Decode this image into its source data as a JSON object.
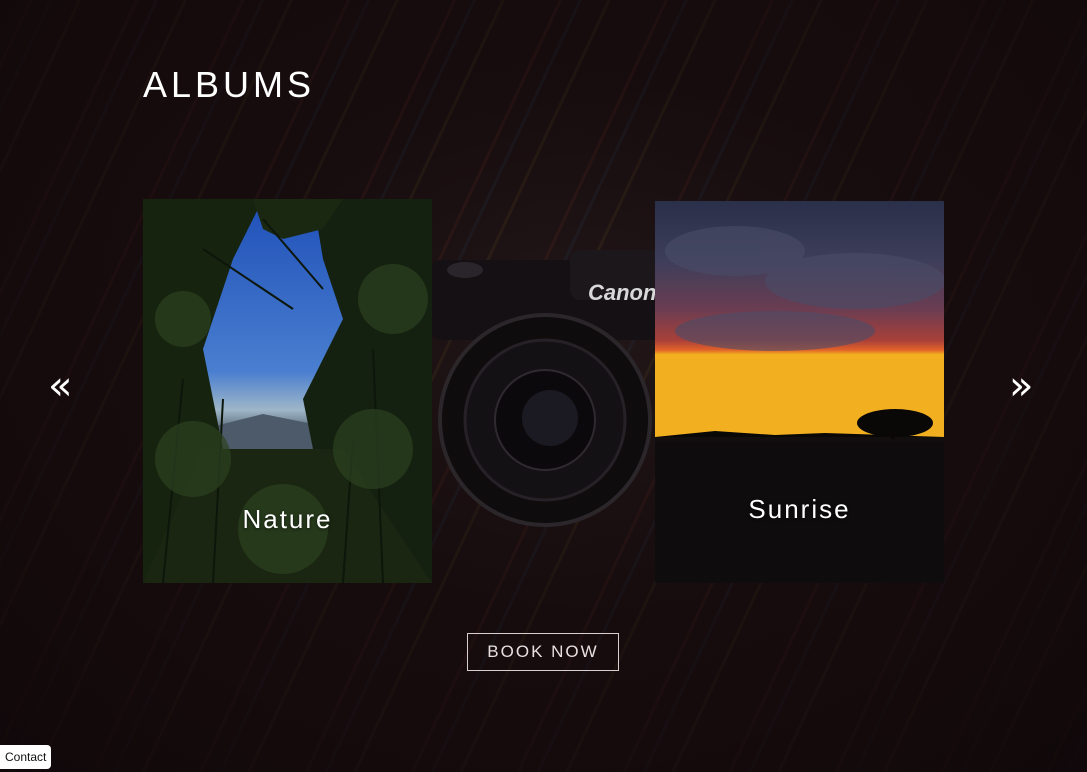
{
  "header": {
    "title": "ALBUMS"
  },
  "carousel": {
    "prev_icon": "«",
    "next_icon": "»",
    "albums": [
      {
        "label": "Nature"
      },
      {
        "label": "Sunrise"
      }
    ]
  },
  "cta": {
    "book_label": "BOOK NOW"
  },
  "widget": {
    "contact_label": "Contact"
  }
}
